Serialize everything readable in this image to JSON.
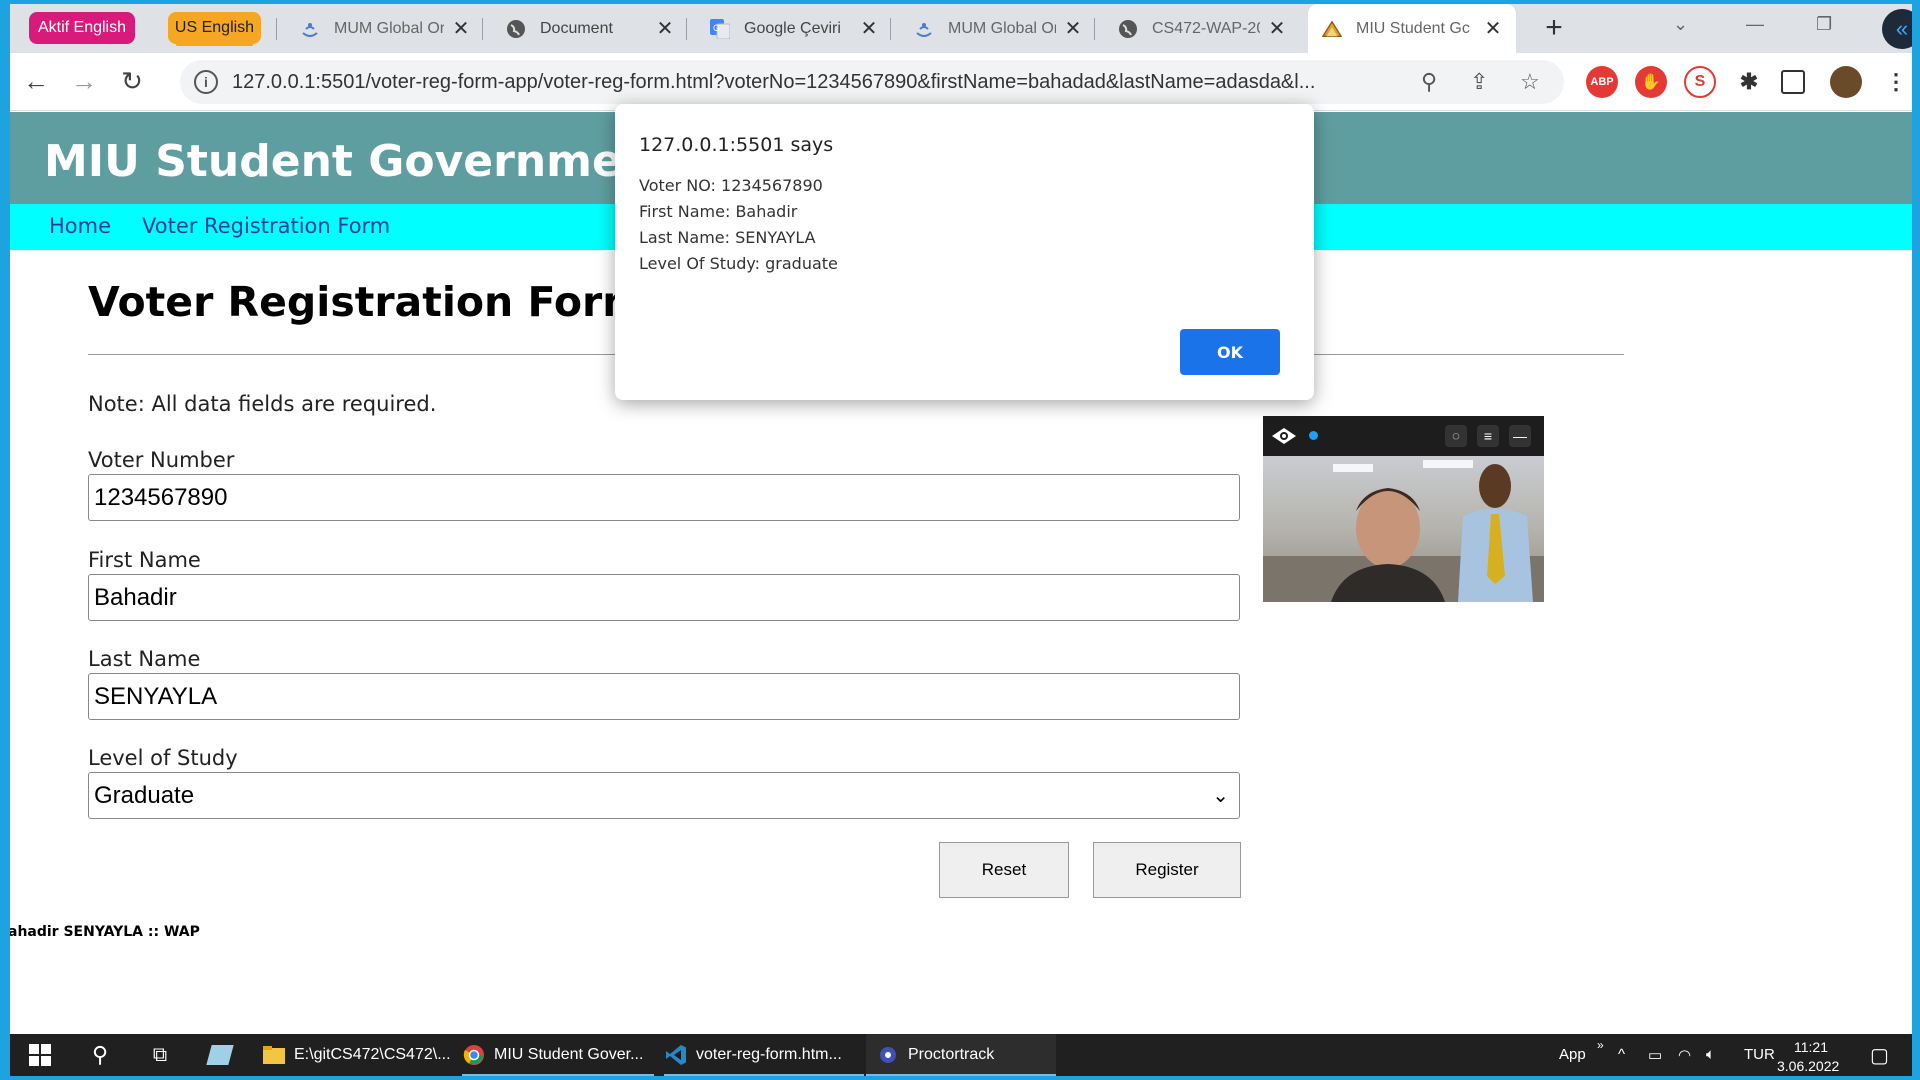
{
  "browser": {
    "ext_buttons": {
      "aktif": "Aktif English",
      "us": "US English"
    },
    "tabs": [
      {
        "label": "MUM Global Or",
        "icon": "mum-icon"
      },
      {
        "label": "Document",
        "icon": "globe-icon"
      },
      {
        "label": "Google Çeviri",
        "icon": "google-translate-icon"
      },
      {
        "label": "MUM Global Or",
        "icon": "mum-icon"
      },
      {
        "label": "CS472-WAP-20",
        "icon": "globe-icon"
      },
      {
        "label": "MIU Student Gc",
        "icon": "miu-icon"
      }
    ],
    "url": "127.0.0.1:5501/voter-reg-form-app/voter-reg-form.html?voterNo=1234567890&firstName=bahadad&lastName=adasda&l...",
    "ext_icons": {
      "abp": "ABP"
    }
  },
  "site": {
    "title": "MIU Student Government",
    "nav": {
      "home": "Home",
      "voter_form": "Voter Registration Form"
    }
  },
  "form": {
    "title": "Voter Registration Form",
    "note": "Note: All data fields are required.",
    "voter_number_label": "Voter Number",
    "voter_number_value": "1234567890",
    "first_name_label": "First Name",
    "first_name_value": "Bahadir",
    "last_name_label": "Last Name",
    "last_name_value": "SENYAYLA",
    "level_label": "Level of Study",
    "level_value": "Graduate",
    "reset_label": "Reset",
    "register_label": "Register"
  },
  "footer": {
    "text": "ahadir SENYAYLA :: WAP"
  },
  "alert": {
    "title": "127.0.0.1:5501 says",
    "lines": [
      "Voter NO: 1234567890",
      "First Name: Bahadir",
      "Last Name: SENYAYLA",
      "Level Of Study: graduate"
    ],
    "ok_label": "OK"
  },
  "taskbar": {
    "items": [
      {
        "label": "E:\\gitCS472\\CS472\\..."
      },
      {
        "label": "MIU Student Gover..."
      },
      {
        "label": "voter-reg-form.htm..."
      },
      {
        "label": "Proctortrack"
      }
    ],
    "tray": {
      "app": "App",
      "lang": "TUR",
      "time": "11:21",
      "date": "3.06.2022"
    }
  },
  "colors": {
    "header_bg": "#5f9ea0",
    "nav_bg": "#00ffff",
    "accent": "#1a73e8"
  }
}
